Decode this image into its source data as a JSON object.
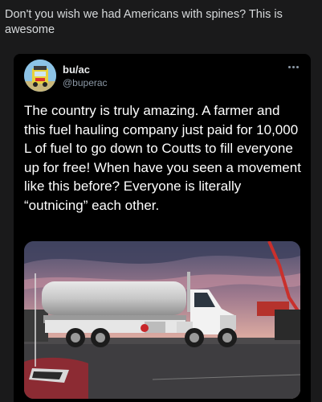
{
  "post": {
    "title": "Don't you wish we had Americans with spines? This is awesome"
  },
  "tweet": {
    "display_name": "bu/ac",
    "handle": "@buperac",
    "text": "The country is truly amazing. A farmer and this fuel hauling company just paid for 10,000 L of fuel to go down to Coutts to fill everyone up for free! When have you seen a movement like this before? Everyone is literally “outnicing” each other.",
    "more_icon": "more-horizontal-icon"
  },
  "photo": {
    "subject": "fuel-tanker-truck"
  }
}
